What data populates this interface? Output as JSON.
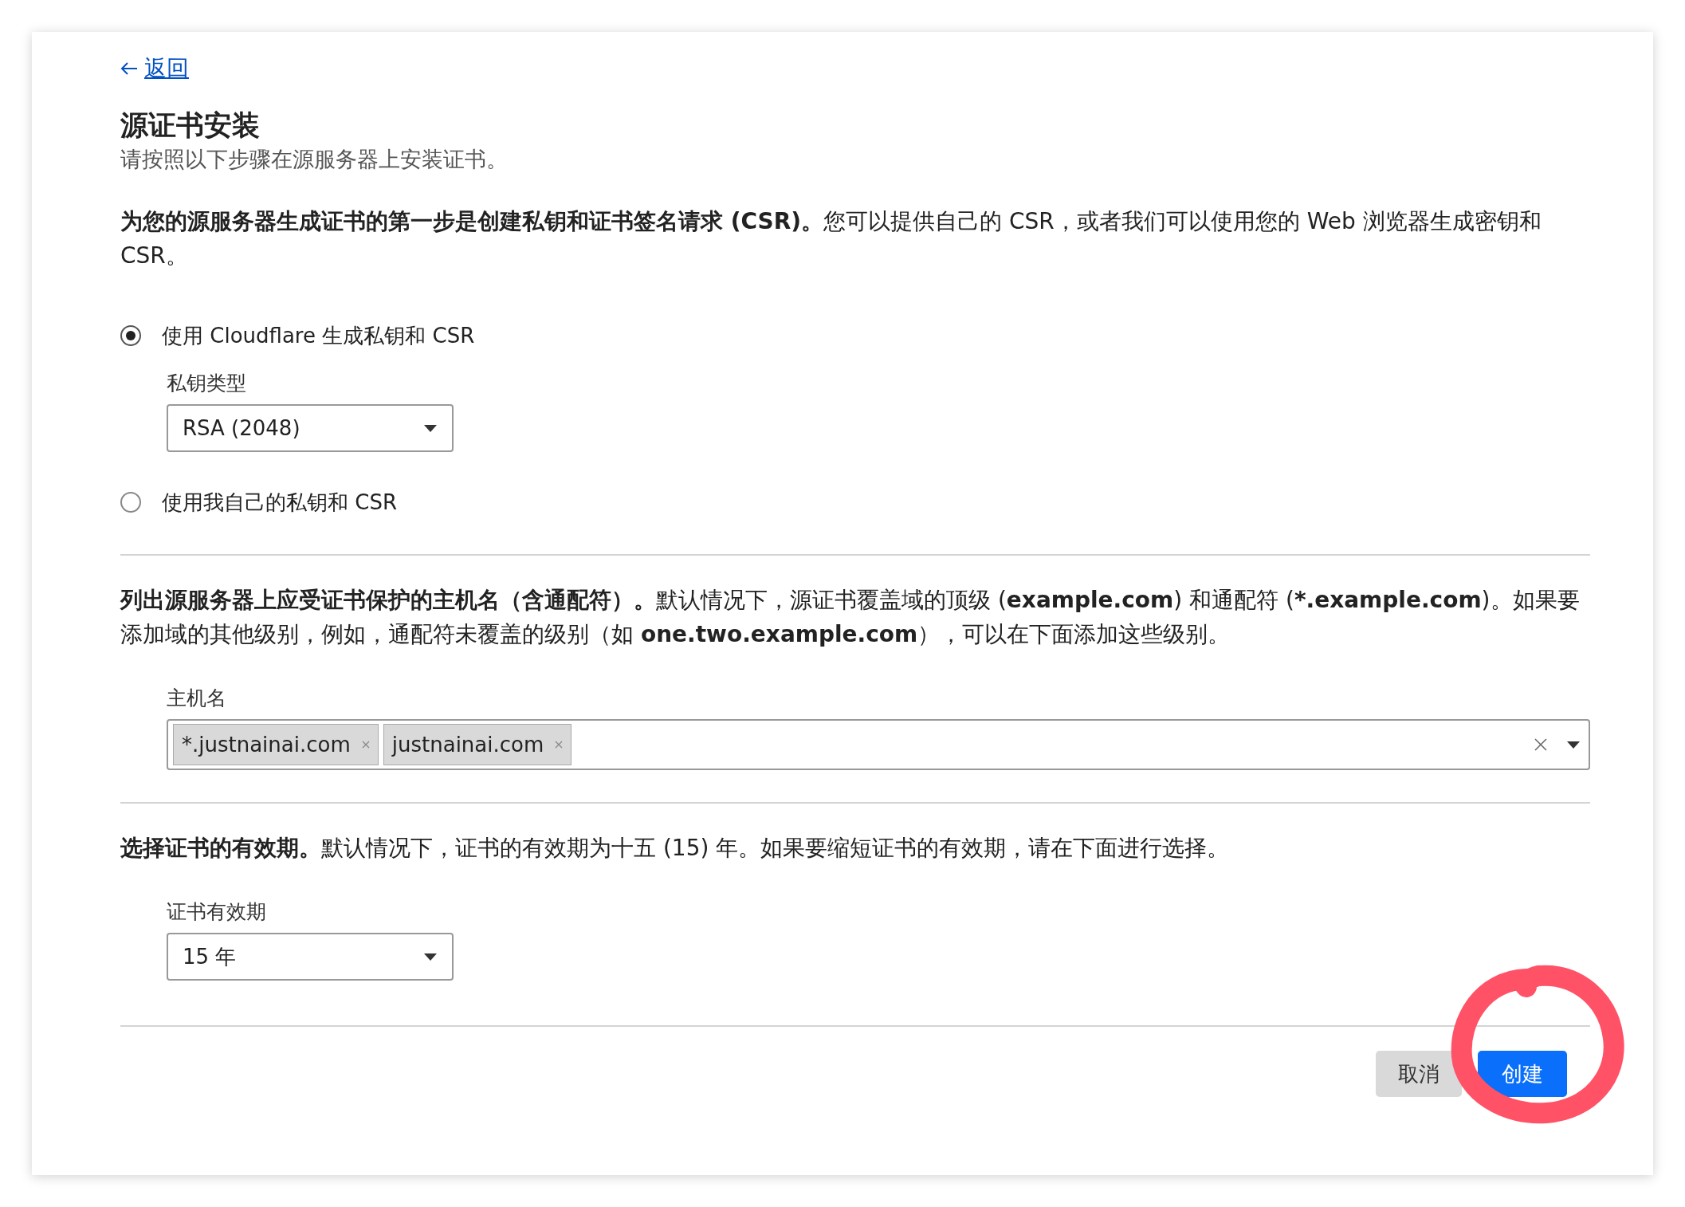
{
  "back_link": {
    "label": "返回"
  },
  "title": "源证书安装",
  "subtitle": "请按照以下步骤在源服务器上安装证书。",
  "steps": [
    {
      "kind": "radio",
      "description": "**为您的源服务器生成证书的第一步是创建私钥和证书签名请求 (CSR)。**您可以提供自己的 CSR，或者我们可以使用您的 Web 浏览器生成密钥和 CSR。",
      "options": [
        {
          "label": "使用 Cloudflare 生成私钥和 CSR",
          "selected": true,
          "field": {
            "label": "私钥类型",
            "value": "RSA (2048)"
          }
        },
        {
          "label": "使用我自己的私钥和 CSR",
          "selected": false
        }
      ]
    },
    {
      "kind": "tags",
      "description": "**列出源服务器上应受证书保护的主机名（含通配符）。**默认情况下，源证书覆盖域的顶级 (**example.com**) 和通配符 (***.example.com**)。如果要添加域的其他级别，例如，通配符未覆盖的级别（如 **one.two.example.com**），可以在下面添加这些级别。",
      "field": {
        "label": "主机名",
        "tags": [
          "*.justnainai.com",
          "justnainai.com"
        ]
      }
    },
    {
      "kind": "select",
      "description": "**选择证书的有效期。**默认情况下，证书的有效期为十五 (15) 年。如果要缩短证书的有效期，请在下面进行选择。",
      "field": {
        "label": "证书有效期",
        "value": "15 年"
      }
    }
  ],
  "buttons": [
    {
      "label": "取消",
      "kind": "secondary"
    },
    {
      "label": "创建",
      "kind": "primary"
    }
  ],
  "annotations": [
    {
      "kind": "circle"
    }
  ]
}
